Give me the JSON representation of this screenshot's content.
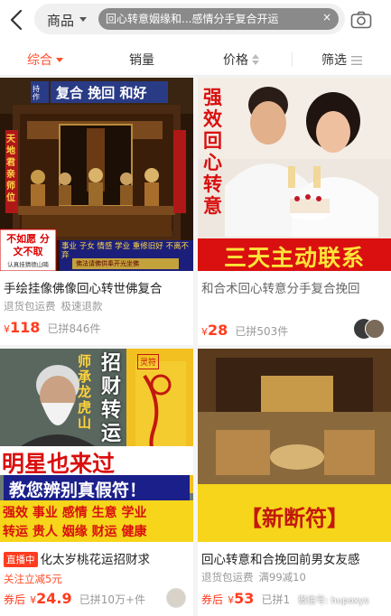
{
  "search": {
    "scope": "商品",
    "query": "回心转意姻缘和...感情分手复合开运",
    "clear_symbol": "×"
  },
  "tabs": [
    {
      "label": "综合"
    },
    {
      "label": "销量"
    },
    {
      "label": "价格"
    },
    {
      "label": "筛选"
    }
  ],
  "colors": {
    "accent": "#ff4f2b",
    "price": "#ff3c1f"
  },
  "products": [
    {
      "image_text": {
        "banner": "复合 挽回 和好",
        "banner_side": "持作",
        "side_left": "天地君亲师位",
        "bottom_left": "不如愿 分文不取",
        "bottom_small": "认真挂猜德山喃",
        "bottom_right": "事业 子女 情感 学业 重修旧好 不离不弃",
        "bottom_right2": "佛法请佛供奉开光坐佛"
      },
      "title": "手绘挂像佛像回心转世佛复合",
      "tags": [
        "退货包运费",
        "极速退款"
      ],
      "price": "118",
      "currency": "¥",
      "sold": "已拼846件"
    },
    {
      "image_text": {
        "vertical": "强效回心转意",
        "banner": "三天主动联系"
      },
      "title": "和合术回心转意分手复合挽回",
      "tags": [],
      "price": "28",
      "currency": "¥",
      "sold": "已拼503件"
    },
    {
      "image_text": {
        "vertical_left": "师承龙虎山",
        "vertical_right": "招财转运",
        "seal": "灵符",
        "line1": "明星也来过",
        "line2": "教您辨别真假符！",
        "grid1": "强效 事业 感情 生意 学业",
        "grid2": "转运 贵人 姻缘 财运 健康"
      },
      "live_badge": "直播中",
      "title": "化太岁桃花运招财求",
      "promo": "关注立减5元",
      "price_prefix": "券后",
      "price": "24.9",
      "currency": "¥",
      "sold": "已拼10万+件"
    },
    {
      "image_text": {
        "banner": "【新断符】"
      },
      "title": "回心转意和合挽回前男女友感",
      "tags": [
        "退货包运费",
        "满99减10"
      ],
      "price_prefix": "券后",
      "price": "53",
      "currency": "¥",
      "sold": "已拼1"
    }
  ],
  "watermark": "微信号: hupoxys"
}
